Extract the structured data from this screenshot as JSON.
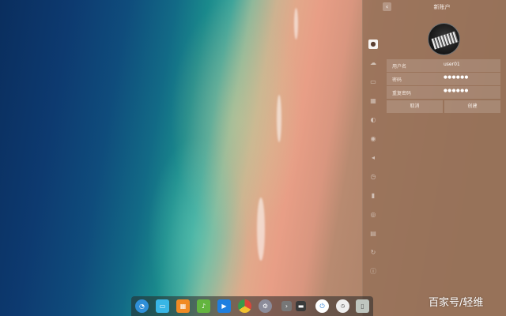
{
  "panel": {
    "title": "新账户",
    "back_icon": "chevron-left-icon",
    "avatar_alt": "piano-keys-avatar"
  },
  "sidebar": {
    "items": [
      {
        "icon": "user-icon",
        "active": true
      },
      {
        "icon": "cloud-icon",
        "active": false
      },
      {
        "icon": "display-icon",
        "active": false
      },
      {
        "icon": "calendar-icon",
        "active": false
      },
      {
        "icon": "palette-icon",
        "active": false
      },
      {
        "icon": "network-icon",
        "active": false
      },
      {
        "icon": "sound-icon",
        "active": false
      },
      {
        "icon": "time-icon",
        "active": false
      },
      {
        "icon": "power-icon",
        "active": false
      },
      {
        "icon": "mouse-icon",
        "active": false
      },
      {
        "icon": "keyboard-icon",
        "active": false
      },
      {
        "icon": "update-icon",
        "active": false
      },
      {
        "icon": "info-icon",
        "active": false
      }
    ]
  },
  "form": {
    "username_label": "用户名",
    "username_value": "user01",
    "password_label": "密码",
    "password_value": "●●●●●●",
    "confirm_label": "重复密码",
    "confirm_value": "●●●●●●"
  },
  "actions": {
    "cancel_label": "取消",
    "create_label": "创建"
  },
  "dock": {
    "items": [
      {
        "icon": "launcher-icon",
        "color": "#2f8fd8"
      },
      {
        "icon": "file-manager-icon",
        "color": "#38b6e6"
      },
      {
        "icon": "app-store-icon",
        "color": "#f08a24"
      },
      {
        "icon": "music-icon",
        "color": "#63b53f"
      },
      {
        "icon": "video-icon",
        "color": "#1e7fe0"
      },
      {
        "icon": "chrome-icon",
        "color": "#d9463a"
      },
      {
        "icon": "settings-icon",
        "color": "#8c8c9a"
      },
      {
        "icon": "arrow-icon",
        "color": "#777777"
      },
      {
        "icon": "terminal-icon",
        "color": "#3a3a3a"
      },
      {
        "icon": "shutdown-icon",
        "color": "#2d7fd6"
      },
      {
        "icon": "clock-icon",
        "color": "#eeeeee"
      },
      {
        "icon": "trash-icon",
        "color": "#bfc6bf"
      }
    ]
  },
  "watermark": "百家号/轻维"
}
